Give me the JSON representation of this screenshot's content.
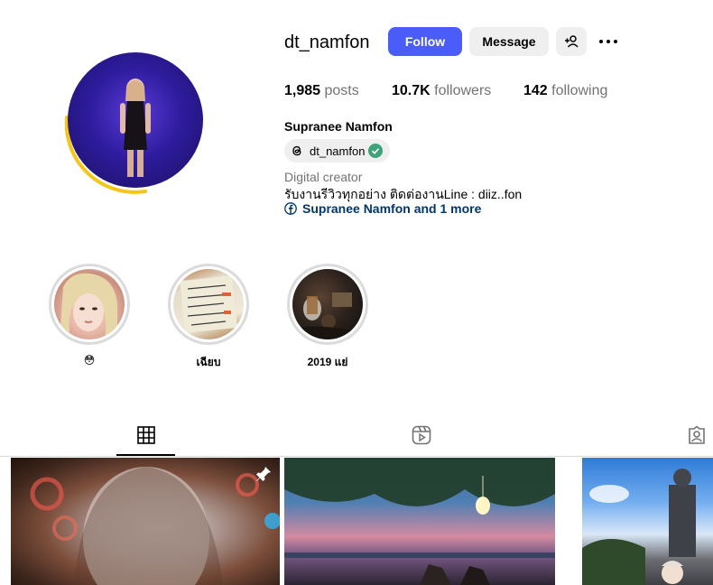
{
  "profile": {
    "username": "dt_namfon",
    "full_name": "Supranee Namfon",
    "threads_handle": "dt_namfon",
    "category": "Digital creator",
    "bio": "รับงานรีวิวทุกอย่าง ติดต่องานLine : diiz..fon",
    "fb_link": "Supranee Namfon and 1 more"
  },
  "actions": {
    "follow_label": "Follow",
    "message_label": "Message"
  },
  "stats": {
    "posts_count": "1,985",
    "posts_label": " posts",
    "followers_count": "10.7K",
    "followers_label": " followers",
    "following_count": "142",
    "following_label": " following"
  },
  "highlights": [
    {
      "label": "😳"
    },
    {
      "label": "เฉียบ"
    },
    {
      "label": "2019 แย่"
    }
  ],
  "tabs": [
    {
      "name": "posts",
      "icon": "grid-icon",
      "active": true
    },
    {
      "name": "reels",
      "icon": "reels-icon",
      "active": false
    },
    {
      "name": "tagged",
      "icon": "tagged-icon",
      "active": false
    }
  ],
  "colors": {
    "accent": "#4a5df9",
    "link": "#00376b",
    "verified": "#3fa37a",
    "story_ring": "#f5c518"
  }
}
